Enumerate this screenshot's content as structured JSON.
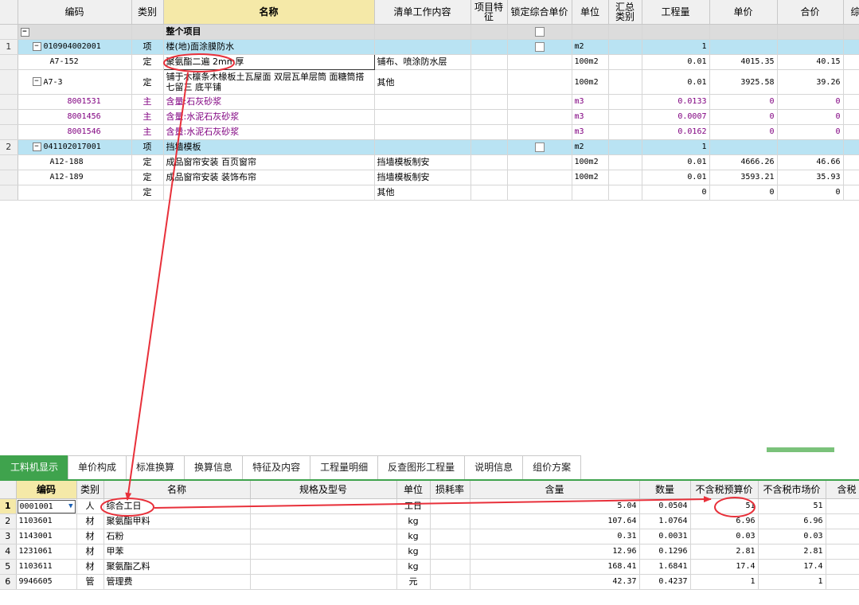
{
  "top": {
    "columns": [
      "编码",
      "类别",
      "名称",
      "清单工作内容",
      "项目特征",
      "锁定综合单价",
      "单位",
      "汇总类别",
      "工程量",
      "单价",
      "合价",
      "综"
    ],
    "whole_label": "整个项目",
    "rows": [
      {
        "n": "1",
        "code": "010904002001",
        "cat": "项",
        "name": "楼(地)面涂膜防水",
        "work": "",
        "unit": "m2",
        "qty": "1",
        "price": "",
        "total": "",
        "kind": "section",
        "lock": true
      },
      {
        "n": "",
        "code": "A7-152",
        "cat": "定",
        "name": "聚氨酯二遍 2mm厚",
        "work": "铺布、喷涂防水层",
        "unit": "100m2",
        "qty": "0.01",
        "price": "4015.35",
        "total": "40.15",
        "kind": "sub",
        "editing": true
      },
      {
        "n": "",
        "code": "A7-3",
        "cat": "定",
        "name": "铺于木檩条木椽板土瓦屋面 双层瓦单层筒 面糖筒搭七留三 底平铺",
        "work": "其他",
        "unit": "100m2",
        "qty": "0.01",
        "price": "3925.58",
        "total": "39.26",
        "kind": "sub-tree"
      },
      {
        "n": "",
        "code": "8001531",
        "cat": "主",
        "name": "含量:石灰砂浆",
        "work": "",
        "unit": "m3",
        "qty": "0.0133",
        "price": "0",
        "total": "0",
        "kind": "main"
      },
      {
        "n": "",
        "code": "8001456",
        "cat": "主",
        "name": "含量:水泥石灰砂浆",
        "work": "",
        "unit": "m3",
        "qty": "0.0007",
        "price": "0",
        "total": "0",
        "kind": "main"
      },
      {
        "n": "",
        "code": "8001546",
        "cat": "主",
        "name": "含量:水泥石灰砂浆",
        "work": "",
        "unit": "m3",
        "qty": "0.0162",
        "price": "0",
        "total": "0",
        "kind": "main"
      },
      {
        "n": "2",
        "code": "041102017001",
        "cat": "项",
        "name": "挡墙模板",
        "work": "",
        "unit": "m2",
        "qty": "1",
        "price": "",
        "total": "",
        "kind": "section",
        "lock": true
      },
      {
        "n": "",
        "code": "A12-188",
        "cat": "定",
        "name": "成品窗帘安装 百页窗帘",
        "work": "挡墙模板制安",
        "unit": "100m2",
        "qty": "0.01",
        "price": "4666.26",
        "total": "46.66",
        "kind": "sub"
      },
      {
        "n": "",
        "code": "A12-189",
        "cat": "定",
        "name": "成品窗帘安装 装饰布帘",
        "work": "挡墙模板制安",
        "unit": "100m2",
        "qty": "0.01",
        "price": "3593.21",
        "total": "35.93",
        "kind": "sub"
      },
      {
        "n": "",
        "code": "",
        "cat": "定",
        "name": "",
        "work": "其他",
        "unit": "",
        "qty": "0",
        "price": "0",
        "total": "0",
        "kind": "sub"
      }
    ]
  },
  "tabs": [
    "工料机显示",
    "单价构成",
    "标准换算",
    "换算信息",
    "特征及内容",
    "工程量明细",
    "反查图形工程量",
    "说明信息",
    "组价方案"
  ],
  "bottom": {
    "columns": [
      "编码",
      "类别",
      "名称",
      "规格及型号",
      "单位",
      "损耗率",
      "含量",
      "数量",
      "不含税预算价",
      "不含税市场价",
      "含税"
    ],
    "rows": [
      {
        "n": "1",
        "code": "0001001",
        "cat": "人",
        "name": "综合工日",
        "spec": "",
        "unit": "工日",
        "loss": "",
        "content": "5.04",
        "qty": "0.0504",
        "budget": "51",
        "market": "51"
      },
      {
        "n": "2",
        "code": "1103601",
        "cat": "材",
        "name": "聚氨酯甲料",
        "spec": "",
        "unit": "kg",
        "loss": "",
        "content": "107.64",
        "qty": "1.0764",
        "budget": "6.96",
        "market": "6.96"
      },
      {
        "n": "3",
        "code": "1143001",
        "cat": "材",
        "name": "石粉",
        "spec": "",
        "unit": "kg",
        "loss": "",
        "content": "0.31",
        "qty": "0.0031",
        "budget": "0.03",
        "market": "0.03"
      },
      {
        "n": "4",
        "code": "1231061",
        "cat": "材",
        "name": "甲苯",
        "spec": "",
        "unit": "kg",
        "loss": "",
        "content": "12.96",
        "qty": "0.1296",
        "budget": "2.81",
        "market": "2.81"
      },
      {
        "n": "5",
        "code": "1103611",
        "cat": "材",
        "name": "聚氨酯乙料",
        "spec": "",
        "unit": "kg",
        "loss": "",
        "content": "168.41",
        "qty": "1.6841",
        "budget": "17.4",
        "market": "17.4"
      },
      {
        "n": "6",
        "code": "9946605",
        "cat": "管",
        "name": "管理费",
        "spec": "",
        "unit": "元",
        "loss": "",
        "content": "42.37",
        "qty": "0.4237",
        "budget": "1",
        "market": "1"
      }
    ]
  },
  "colors": {
    "accent_green": "#3fa34d",
    "section_blue": "#b9e3f3",
    "header_yellow": "#f5e9a8",
    "annotation_red": "#e8303a",
    "main_purple": "#800080"
  }
}
